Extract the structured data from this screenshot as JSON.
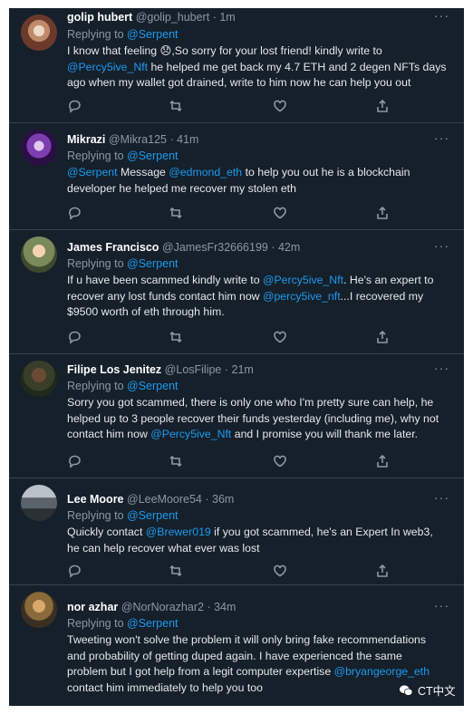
{
  "replying_label": "Replying to",
  "more_glyph": "···",
  "tweets": [
    {
      "name": "golip hubert",
      "handle": "@golip_hubert",
      "time": "· 1m",
      "mention": "@Serpent",
      "l1a": "I know that feeling 😞,So sorry for your lost friend! kindly write to",
      "l2link": "@Percy5ive_Nft",
      "l2b": " he helped me get back my 4.7 ETH and 2 degen NFTs days",
      "l3": "ago when my wallet got drained, write to him now he can help you out"
    },
    {
      "name": "Mikrazi",
      "handle": "@Mikra125",
      "time": "· 41m",
      "mention": "@Serpent",
      "l1link1": "@Serpent",
      "l1b": " Message ",
      "l1link2": "@edmond_eth",
      "l1c": " to help you out he is a blockchain",
      "l2": "developer he helped me recover my stolen eth"
    },
    {
      "name": "James Francisco",
      "handle": "@JamesFr32666199",
      "time": "· 42m",
      "mention": "@Serpent",
      "l1a": "If u have been scammed kindly write to ",
      "l1link": "@Percy5ive_Nft",
      "l1b": ".  He's an expert to",
      "l2a": "recover any lost funds contact him now ",
      "l2link": "@percy5ive_nft",
      "l2b": "...I recovered my",
      "l3": "$9500 worth of eth through him."
    },
    {
      "name": "Filipe Los Jenitez",
      "handle": "@LosFilipe",
      "time": "· 21m",
      "mention": "@Serpent",
      "l1": "Sorry you got scammed, there is only one who I'm pretty sure can help, he",
      "l2": "helped up to 3 people recover their funds yesterday (including me), why not",
      "l3a": "contact him now ",
      "l3link": "@Percy5ive_Nft",
      "l3b": " and I promise you will thank me later."
    },
    {
      "name": "Lee Moore",
      "handle": "@LeeMoore54",
      "time": "· 36m",
      "mention": "@Serpent",
      "l1a": "Quickly contact ",
      "l1link": "@Brewer019",
      "l1b": " if you got scammed, he's an Expert In web3,",
      "l2": "he can help recover what ever was lost"
    },
    {
      "name": "nor azhar",
      "handle": "@NorNorazhar2",
      "time": "· 34m",
      "mention": "@Serpent",
      "l1": "Tweeting won't solve the problem it will only bring fake recommendations",
      "l2": "and probability of getting duped again. I have experienced the same",
      "l3a": "problem but I got help from a legit computer expertise ",
      "l3link": "@bryangeorge_eth",
      "l4": "contact him immediately to help you too"
    }
  ],
  "watermark": "CT中文",
  "colors": {
    "bg": "#15202b",
    "link": "#1d9bf0",
    "muted": "#8b98a5",
    "text": "#e7e9ea"
  }
}
